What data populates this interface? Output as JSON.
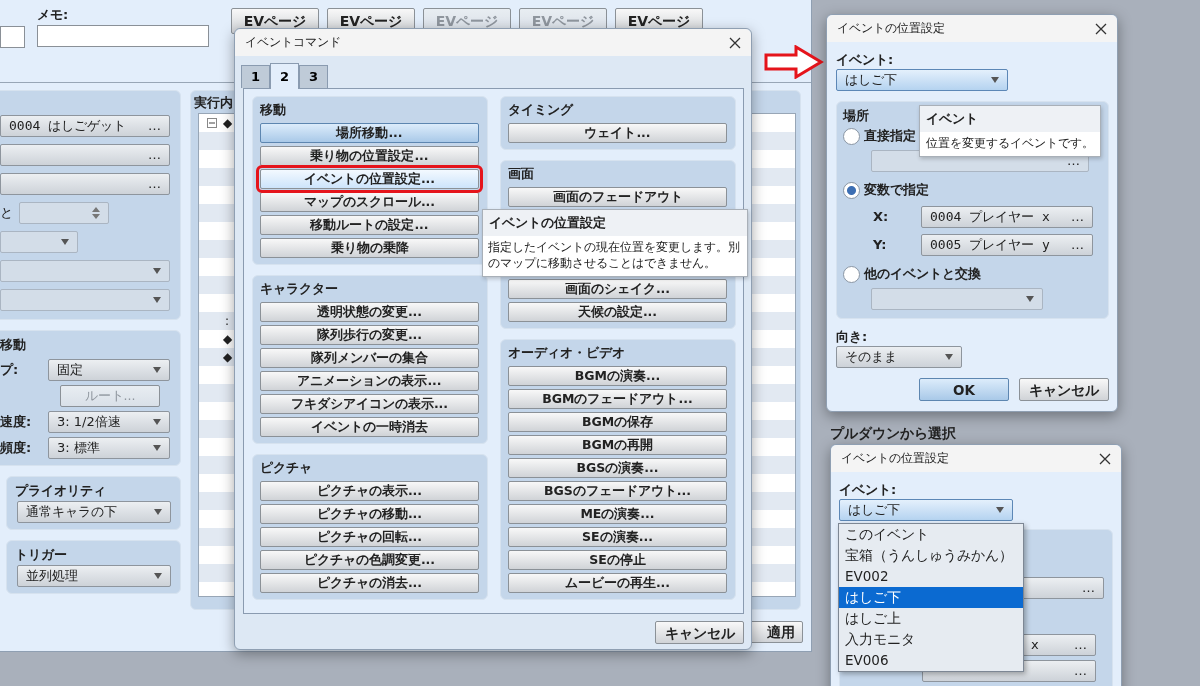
{
  "editor": {
    "memo_label": "メモ:",
    "ev_page_tabs": [
      {
        "label": "EVページ",
        "disabled": false
      },
      {
        "label": "EVページ",
        "disabled": false
      },
      {
        "label": "EVページ",
        "disabled": true
      },
      {
        "label": "EVページ",
        "disabled": true
      },
      {
        "label": "EVページ",
        "disabled": false
      }
    ],
    "event_fields": [
      {
        "kind": "browse",
        "value": "0004 はしごゲット",
        "button": "…"
      },
      {
        "kind": "browse",
        "button": "…"
      },
      {
        "kind": "browse",
        "button": "…"
      },
      {
        "kind": "spin",
        "label": "と"
      },
      {
        "kind": "combo"
      },
      {
        "kind": "dropdown"
      },
      {
        "kind": "dropdown"
      }
    ],
    "movement": {
      "title": "移動",
      "rows": [
        {
          "kind": "dropdown",
          "label": "プ:",
          "value": "固定"
        },
        {
          "kind": "button",
          "value": "ルート...",
          "disabled": true
        },
        {
          "kind": "dropdown",
          "label": "速度:",
          "value": "3: 1/2倍速"
        },
        {
          "kind": "dropdown",
          "label": "頻度:",
          "value": "3: 標準"
        }
      ]
    },
    "priority": {
      "title": "プライオリティ",
      "value": "通常キャラの下"
    },
    "trigger": {
      "title": "トリガー",
      "value": "並列処理"
    },
    "contents": {
      "title": "実行内",
      "rows": [
        {
          "text": "◆",
          "expanded": true
        },
        {
          "text": ":"
        },
        {
          "text": "◆"
        },
        {
          "text": "◆"
        }
      ]
    },
    "apply_button": "適用"
  },
  "command_dialog": {
    "title": "イベントコマンド",
    "tabs": [
      {
        "label": "1",
        "selected": false
      },
      {
        "label": "2",
        "selected": true
      },
      {
        "label": "3",
        "selected": false
      }
    ],
    "left_groups": [
      {
        "title": "移動",
        "buttons": [
          {
            "label": "場所移動...",
            "focused": true,
            "hovered": false,
            "marked": false
          },
          {
            "label": "乗り物の位置設定...",
            "focused": false,
            "hovered": false,
            "marked": false
          },
          {
            "label": "イベントの位置設定...",
            "focused": false,
            "hovered": true,
            "marked": true
          },
          {
            "label": "マップのスクロール...",
            "focused": false,
            "hovered": false,
            "marked": false
          },
          {
            "label": "移動ルートの設定...",
            "focused": false,
            "hovered": false,
            "marked": false
          },
          {
            "label": "乗り物の乗降",
            "focused": false,
            "hovered": false,
            "marked": false
          }
        ]
      },
      {
        "title": "キャラクター",
        "buttons": [
          {
            "label": "透明状態の変更..."
          },
          {
            "label": "隊列歩行の変更..."
          },
          {
            "label": "隊列メンバーの集合"
          },
          {
            "label": "アニメーションの表示..."
          },
          {
            "label": "フキダシアイコンの表示..."
          },
          {
            "label": "イベントの一時消去"
          }
        ]
      },
      {
        "title": "ピクチャ",
        "buttons": [
          {
            "label": "ピクチャの表示..."
          },
          {
            "label": "ピクチャの移動..."
          },
          {
            "label": "ピクチャの回転..."
          },
          {
            "label": "ピクチャの色調変更..."
          },
          {
            "label": "ピクチャの消去..."
          }
        ]
      }
    ],
    "right_groups": [
      {
        "title": "タイミング",
        "buttons": [
          {
            "label": "ウェイト..."
          }
        ]
      },
      {
        "title": "画面",
        "buttons": [
          {
            "label": "画面のフェードアウト"
          },
          {
            "label": "画面のシェイク..."
          },
          {
            "label": "天候の設定..."
          }
        ]
      },
      {
        "title": "オーディオ・ビデオ",
        "buttons": [
          {
            "label": "BGMの演奏..."
          },
          {
            "label": "BGMのフェードアウト..."
          },
          {
            "label": "BGMの保存"
          },
          {
            "label": "BGMの再開"
          },
          {
            "label": "BGSの演奏..."
          },
          {
            "label": "BGSのフェードアウト..."
          },
          {
            "label": "MEの演奏..."
          },
          {
            "label": "SEの演奏..."
          },
          {
            "label": "SEの停止"
          },
          {
            "label": "ムービーの再生..."
          }
        ]
      }
    ],
    "tooltip": {
      "title": "イベントの位置設定",
      "text": "指定したイベントの現在位置を変更します。別のマップに移動させることはできません。"
    },
    "cancel_button": "キャンセル"
  },
  "position_dialog": {
    "title": "イベントの位置設定",
    "event_label": "イベント:",
    "event_value": "はしご下",
    "location": {
      "title": "場所",
      "options": [
        {
          "label": "直接指定",
          "selected": false
        },
        {
          "label": "変数で指定",
          "selected": true
        },
        {
          "label": "他のイベントと交換",
          "selected": false
        }
      ],
      "direct_button": "…",
      "x": {
        "label": "X:",
        "value": "0004 プレイヤー x",
        "button": "…"
      },
      "y": {
        "label": "Y:",
        "value": "0005 プレイヤー y",
        "button": "…"
      }
    },
    "tooltip": {
      "title": "イベント",
      "text": "位置を変更するイベントです。"
    },
    "direction_label": "向き:",
    "direction_value": "そのまま",
    "ok_button": "OK",
    "cancel_button": "キャンセル"
  },
  "pulldown_caption": "プルダウンから選択",
  "pulldown_dialog": {
    "title": "イベントの位置設定",
    "event_label": "イベント:",
    "event_value": "はしご下",
    "options": [
      {
        "label": "このイベント",
        "selected": false
      },
      {
        "label": "宝箱（うんしゅうみかん）",
        "selected": false
      },
      {
        "label": "EV002",
        "selected": false
      },
      {
        "label": "はしご下",
        "selected": true
      },
      {
        "label": "はしご上",
        "selected": false
      },
      {
        "label": "入力モニタ",
        "selected": false
      },
      {
        "label": "EV006",
        "selected": false
      }
    ],
    "fields": [
      {
        "button": "…"
      },
      {
        "value": "x",
        "button": "…"
      },
      {
        "button": "…"
      }
    ]
  }
}
